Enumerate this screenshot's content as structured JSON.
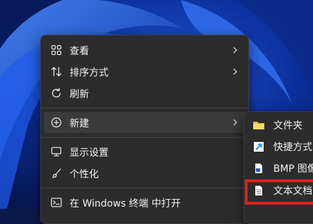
{
  "context_menu": {
    "items": [
      {
        "label": "查看",
        "icon": "grid-icon",
        "has_submenu": true
      },
      {
        "label": "排序方式",
        "icon": "sort-icon",
        "has_submenu": true
      },
      {
        "label": "刷新",
        "icon": "refresh-icon",
        "has_submenu": false
      },
      {
        "label": "新建",
        "icon": "add-circle-icon",
        "has_submenu": true,
        "active": true
      },
      {
        "label": "显示设置",
        "icon": "display-icon",
        "has_submenu": false
      },
      {
        "label": "个性化",
        "icon": "brush-icon",
        "has_submenu": false
      },
      {
        "label": "在 Windows 终端 中打开",
        "icon": "terminal-icon",
        "has_submenu": false
      }
    ]
  },
  "new_submenu": {
    "items": [
      {
        "label": "文件夹",
        "icon": "folder-icon"
      },
      {
        "label": "快捷方式",
        "icon": "shortcut-icon"
      },
      {
        "label": "BMP 图像",
        "icon": "bmp-image-icon"
      },
      {
        "label": "文本文档",
        "icon": "text-document-icon",
        "highlighted": true
      }
    ]
  },
  "colors": {
    "menu_bg": "#2c2c2c",
    "highlight_border": "#e0201c",
    "folder": "#f5c242",
    "shortcut_arrow": "#2b8ef0"
  }
}
